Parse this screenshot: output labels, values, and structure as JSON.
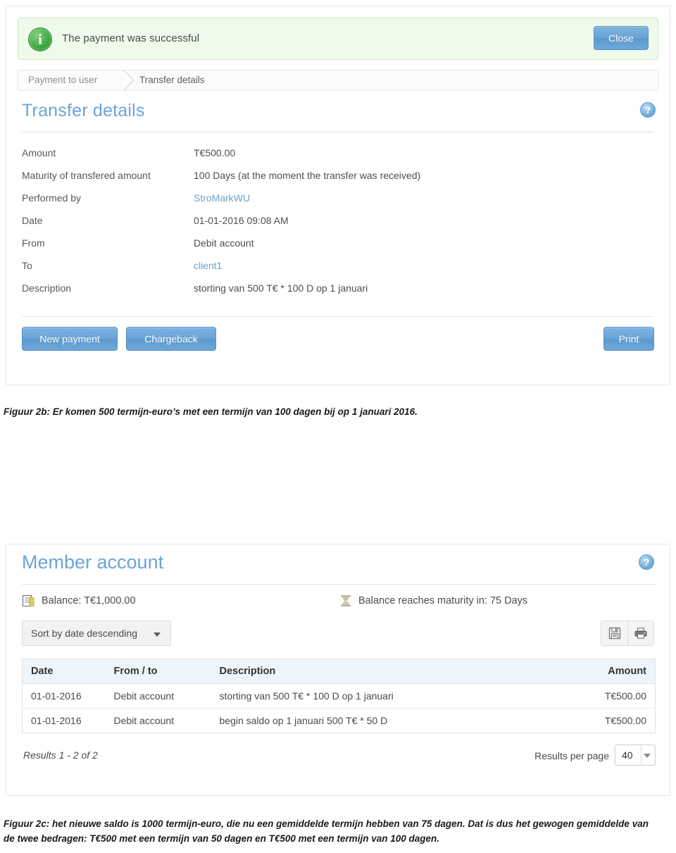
{
  "figure_2b": {
    "alert": {
      "icon": "info-icon",
      "message": "The payment was successful",
      "close_label": "Close",
      "bg_color": "#eefaea",
      "border_color": "#cfe8c6",
      "icon_color": "#3faa43"
    },
    "breadcrumb": {
      "items": [
        "Payment to user",
        "Transfer details"
      ]
    },
    "card": {
      "title": "Transfer details",
      "title_color": "#6ba4d8",
      "help_icon": "question-mark-icon",
      "rows": [
        {
          "label": "Amount",
          "value": "T€500.00",
          "is_link": false
        },
        {
          "label": "Maturity of transfered amount",
          "value": "100 Days (at the moment the transfer was received)",
          "is_link": false
        },
        {
          "label": "Performed by",
          "value": "StroMarkWU",
          "is_link": true
        },
        {
          "label": "Date",
          "value": "01-01-2016 09:08 AM",
          "is_link": false
        },
        {
          "label": "From",
          "value": "Debit account",
          "is_link": false
        },
        {
          "label": "To",
          "value": "client1",
          "is_link": true
        },
        {
          "label": "Description",
          "value": "storting van 500 T€ * 100 D op 1 januari",
          "is_link": false
        }
      ],
      "buttons": {
        "new_payment": "New payment",
        "chargeback": "Chargeback",
        "print": "Print"
      }
    }
  },
  "caption_2b": "Figuur 2b: Er komen 500 termijn-euro’s met een termijn van 100 dagen bij op 1 januari 2016.",
  "figure_2c": {
    "title": "Member account",
    "title_color": "#6ba4d8",
    "help_icon": "question-mark-icon",
    "stats": {
      "balance": "Balance: T€1,000.00",
      "balance_icon": "ledger-icon",
      "maturity": "Balance reaches maturity in: 75 Days",
      "maturity_icon": "hourglass-icon"
    },
    "sort": {
      "label": "Sort by date descending",
      "caret_icon": "chevron-down-icon"
    },
    "tools": [
      {
        "name": "save-icon",
        "title": "Save"
      },
      {
        "name": "print-icon",
        "title": "Print"
      }
    ],
    "table": {
      "columns": [
        "Date",
        "From / to",
        "Description",
        "Amount"
      ],
      "rows": [
        [
          "01-01-2016",
          "Debit account",
          "storting van 500 T€ * 100 D op 1 januari",
          "T€500.00"
        ],
        [
          "01-01-2016",
          "Debit account",
          "begin saldo op 1 januari 500 T€ * 50 D",
          "T€500.00"
        ]
      ]
    },
    "footer": {
      "results": "Results 1 - 2 of 2",
      "results_per_page_label": "Results per page",
      "results_per_page_value": "40"
    }
  },
  "caption_2c": "Figuur 2c: het nieuwe saldo is 1000 termijn-euro, die nu een gemiddelde termijn hebben van 75 dagen. Dat is dus het gewogen gemiddelde van de twee bedragen: T€500 met een termijn van 50 dagen en T€500 met een termijn van 100 dagen."
}
